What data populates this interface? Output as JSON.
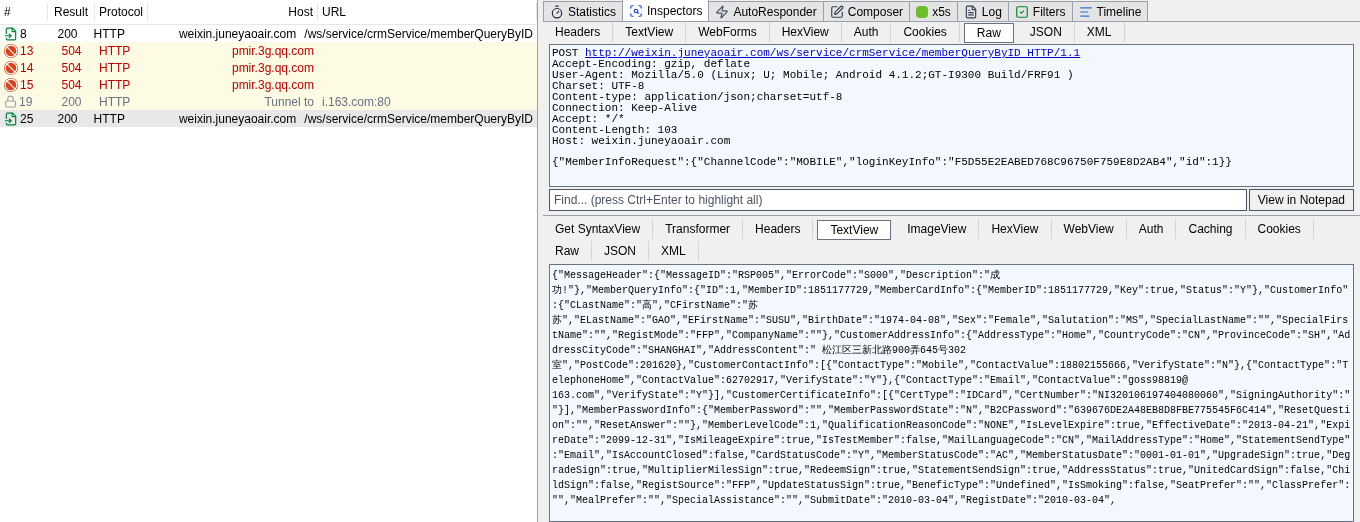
{
  "sessions": {
    "columns": [
      "#",
      "Result",
      "Protocol",
      "Host",
      "URL"
    ],
    "rows": [
      {
        "kind": "ok",
        "selected": false,
        "id": "8",
        "result": "200",
        "protocol": "HTTP",
        "host": "weixin.juneyaoair.com",
        "url": "/ws/service/crmService/memberQueryByID"
      },
      {
        "kind": "error",
        "selected": false,
        "id": "13",
        "result": "504",
        "protocol": "HTTP",
        "host": "pmir.3g.qq.com",
        "url": ""
      },
      {
        "kind": "error",
        "selected": false,
        "id": "14",
        "result": "504",
        "protocol": "HTTP",
        "host": "pmir.3g.qq.com",
        "url": ""
      },
      {
        "kind": "error",
        "selected": false,
        "id": "15",
        "result": "504",
        "protocol": "HTTP",
        "host": "pmir.3g.qq.com",
        "url": ""
      },
      {
        "kind": "tunnel",
        "selected": false,
        "id": "19",
        "result": "200",
        "protocol": "HTTP",
        "host": "Tunnel to",
        "url": "i.163.com:80"
      },
      {
        "kind": "ok",
        "selected": true,
        "id": "25",
        "result": "200",
        "protocol": "HTTP",
        "host": "weixin.juneyaoair.com",
        "url": "/ws/service/crmService/memberQueryByID"
      }
    ]
  },
  "main_tabs": [
    {
      "kind": "statistics",
      "label": "Statistics",
      "selected": false
    },
    {
      "kind": "inspectors",
      "label": "Inspectors",
      "selected": true
    },
    {
      "kind": "autoresponder",
      "label": "AutoResponder",
      "selected": false
    },
    {
      "kind": "composer",
      "label": "Composer",
      "selected": false
    },
    {
      "kind": "x5s",
      "label": "x5s",
      "selected": false
    },
    {
      "kind": "log",
      "label": "Log",
      "selected": false
    },
    {
      "kind": "filters",
      "label": "Filters",
      "selected": false
    },
    {
      "kind": "timeline",
      "label": "Timeline",
      "selected": false
    }
  ],
  "request": {
    "tabs": [
      {
        "label": "Headers",
        "selected": false
      },
      {
        "label": "TextView",
        "selected": false
      },
      {
        "label": "WebForms",
        "selected": false
      },
      {
        "label": "HexView",
        "selected": false
      },
      {
        "label": "Auth",
        "selected": false
      },
      {
        "label": "Cookies",
        "selected": false
      },
      {
        "label": "Raw",
        "selected": true
      },
      {
        "label": "JSON",
        "selected": false
      },
      {
        "label": "XML",
        "selected": false
      }
    ],
    "method": "POST",
    "url": "http://weixin.juneyaoair.com/ws/service/crmService/memberQueryByID HTTP/1.1",
    "headers": [
      "Accept-Encoding: gzip, deflate",
      "User-Agent: Mozilla/5.0 (Linux; U; Mobile; Android 4.1.2;GT-I9300 Build/FRF91 )",
      "Charset: UTF-8",
      "Content-type: application/json;charset=utf-8",
      "Connection: Keep-Alive",
      "Accept: */*",
      "Content-Length: 103",
      "Host: weixin.juneyaoair.com"
    ],
    "body": "{\"MemberInfoRequest\":{\"ChannelCode\":\"MOBILE\",\"loginKeyInfo\":\"F5D55E2EABED768C96750F759E8D2AB4\",\"id\":1}}",
    "find_placeholder": "Find... (press Ctrl+Enter to highlight all)",
    "notepad_button": "View in Notepad"
  },
  "response": {
    "tabs": [
      {
        "label": "Get SyntaxView",
        "selected": false
      },
      {
        "label": "Transformer",
        "selected": false
      },
      {
        "label": "Headers",
        "selected": false
      },
      {
        "label": "TextView",
        "selected": true
      },
      {
        "label": "ImageView",
        "selected": false
      },
      {
        "label": "HexView",
        "selected": false
      },
      {
        "label": "WebView",
        "selected": false
      },
      {
        "label": "Auth",
        "selected": false
      },
      {
        "label": "Caching",
        "selected": false
      },
      {
        "label": "Cookies",
        "selected": false
      },
      {
        "label": "Raw",
        "selected": false
      },
      {
        "label": "JSON",
        "selected": false
      },
      {
        "label": "XML",
        "selected": false
      }
    ],
    "lines": [
      "{\"MessageHeader\":{\"MessageID\":\"RSP005\",\"ErrorCode\":\"S000\",\"Description\":\"成",
      "功!\"},\"MemberQueryInfo\":{\"ID\":1,\"MemberID\":1851177729,\"MemberCardInfo\":{\"MemberID\":1851177729,\"Key\":true,\"Status\":\"Y\"},\"CustomerInfo\"",
      ":{\"CLastName\":\"高\",\"CFirstName\":\"苏",
      "苏\",\"ELastName\":\"GAO\",\"EFirstName\":\"SUSU\",\"BirthDate\":\"1974-04-08\",\"Sex\":\"Female\",\"Salutation\":\"MS\",\"SpecialLastName\":\"\",\"SpecialFirs",
      "tName\":\"\",\"RegistMode\":\"FFP\",\"CompanyName\":\"\"},\"CustomerAddressInfo\":{\"AddressType\":\"Home\",\"CountryCode\":\"CN\",\"ProvinceCode\":\"SH\",\"Ad",
      "dressCityCode\":\"SHANGHAI\",\"AddressContent\":\" 松江区三新北路900弄645号302",
      "室\",\"PostCode\":201620},\"CustomerContactInfo\":[{\"ContactType\":\"Mobile\",\"ContactValue\":18802155666,\"VerifyState\":\"N\"},{\"ContactType\":\"T",
      "elephoneHome\",\"ContactValue\":62702917,\"VerifyState\":\"Y\"},{\"ContactType\":\"Email\",\"ContactValue\":\"goss98819@",
      "163.com\",\"VerifyState\":\"Y\"}],\"CustomerCertificateInfo\":[{\"CertType\":\"IDCard\",\"CertNumber\":\"NI320106197404080060\",\"SigningAuthority\":\"",
      "\"}],\"MemberPasswordInfo\":{\"MemberPassword\":\"\",\"MemberPasswordState\":\"N\",\"B2CPassword\":\"639676DE2A48EB8D8FBE775545F6C414\",\"ResetQuesti",
      "on\":\"\",\"ResetAnswer\":\"\"},\"MemberLevelCode\":1,\"QualificationReasonCode\":\"NONE\",\"IsLevelExpire\":true,\"EffectiveDate\":\"2013-04-21\",\"Expi",
      "reDate\":\"2099-12-31\",\"IsMileageExpire\":true,\"IsTestMember\":false,\"MailLanguageCode\":\"CN\",\"MailAddressType\":\"Home\",\"StatementSendType\"",
      ":\"Email\",\"IsAccountClosed\":false,\"CardStatusCode\":\"Y\",\"MemberStatusCode\":\"AC\",\"MemberStatusDate\":\"0001-01-01\",\"UpgradeSign\":true,\"Deg",
      "radeSign\":true,\"MultiplierMilesSign\":true,\"RedeemSign\":true,\"StatementSendSign\":true,\"AddressStatus\":true,\"UnitedCardSign\":false,\"Chi",
      "ldSign\":false,\"RegistSource\":\"FFP\",\"UpdateStatusSign\":true,\"BeneficType\":\"Undefined\",\"IsSmoking\":false,\"SeatPrefer\":\"\",\"ClassPrefer\":",
      "\"\",\"MealPrefer\":\"\",\"SpecialAssistance\":\"\",\"SubmitDate\":\"2010-03-04\",\"RegistDate\":\"2010-03-04\","
    ]
  }
}
